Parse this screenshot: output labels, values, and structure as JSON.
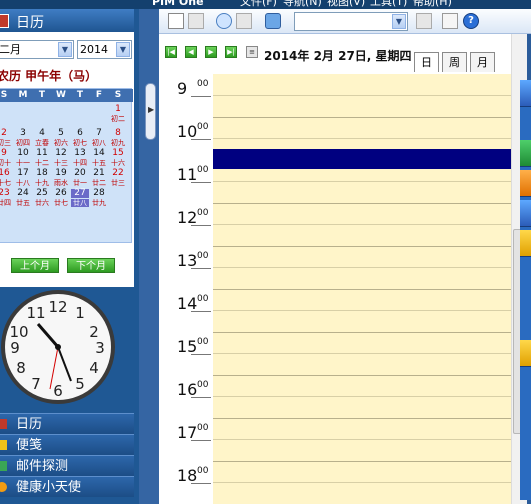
{
  "app": {
    "name": "PIM One"
  },
  "menu": [
    "文件(F)",
    "导航(N)",
    "视图(V)",
    "工具(T)",
    "帮助(H)"
  ],
  "calendar_panel": {
    "header": "日历",
    "month_select": "二月",
    "year_select": "2014",
    "lunar_year": "农历 甲午年（马）",
    "weekdays": [
      "S",
      "M",
      "T",
      "W",
      "T",
      "F",
      "S"
    ],
    "rows": [
      {
        "days": [
          "",
          "",
          "",
          "",
          "",
          "",
          "1"
        ],
        "lunar": [
          "",
          "",
          "",
          "",
          "",
          "",
          "初二"
        ]
      },
      {
        "days": [
          "2",
          "3",
          "4",
          "5",
          "6",
          "7",
          "8"
        ],
        "lunar": [
          "初三",
          "初四",
          "立春",
          "初六",
          "初七",
          "初八",
          "初九"
        ]
      },
      {
        "days": [
          "9",
          "10",
          "11",
          "12",
          "13",
          "14",
          "15"
        ],
        "lunar": [
          "初十",
          "十一",
          "十二",
          "十三",
          "十四",
          "十五",
          "十六"
        ]
      },
      {
        "days": [
          "16",
          "17",
          "18",
          "19",
          "20",
          "21",
          "22"
        ],
        "lunar": [
          "十七",
          "十八",
          "十九",
          "雨水",
          "廿一",
          "廿二",
          "廿三"
        ]
      },
      {
        "days": [
          "23",
          "24",
          "25",
          "26",
          "27",
          "28",
          ""
        ],
        "lunar": [
          "廿四",
          "廿五",
          "廿六",
          "廿七",
          "廿八",
          "廿九",
          ""
        ]
      }
    ],
    "today": "27",
    "prev_month": "上个月",
    "next_month": "下个月"
  },
  "nav_items": [
    {
      "label": "日历",
      "icon": "calendar-icon",
      "color": "#c0392b"
    },
    {
      "label": "便笺",
      "icon": "note-icon",
      "color": "#f0c419"
    },
    {
      "label": "邮件探测",
      "icon": "mail-icon",
      "color": "#3aa655"
    },
    {
      "label": "健康小天使",
      "icon": "health-icon",
      "color": "#f39c12"
    }
  ],
  "date_header": "2014年 2月 27日, 星期四",
  "view_tabs": [
    "日",
    "周",
    "月"
  ],
  "hours": [
    {
      "h": "9",
      "m": "00"
    },
    {
      "h": "10",
      "m": "00"
    },
    {
      "h": "11",
      "m": "00"
    },
    {
      "h": "12",
      "m": "00"
    },
    {
      "h": "13",
      "m": "00"
    },
    {
      "h": "14",
      "m": "00"
    },
    {
      "h": "15",
      "m": "00"
    },
    {
      "h": "16",
      "m": "00"
    },
    {
      "h": "17",
      "m": "00"
    },
    {
      "h": "18",
      "m": "00"
    }
  ],
  "colors": {
    "slot_bg": "#fff5c9",
    "selected_slot": "#000080",
    "panel_blue": "#1f5894"
  }
}
